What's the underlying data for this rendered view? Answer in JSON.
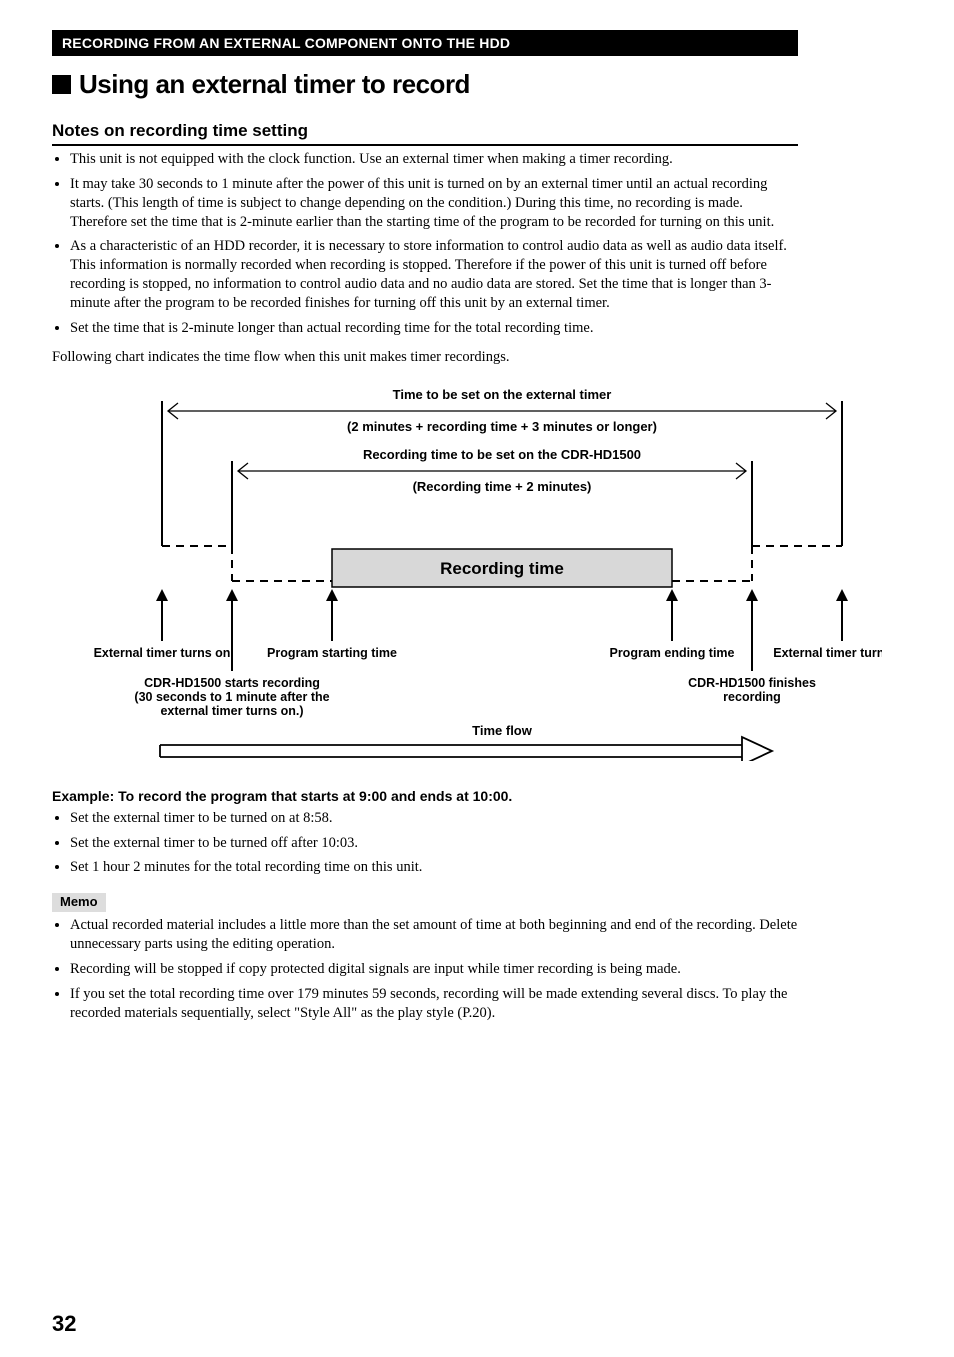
{
  "header_bar": "RECORDING FROM AN EXTERNAL COMPONENT ONTO THE HDD",
  "h1": "Using an external timer to record",
  "h2": "Notes on recording time setting",
  "notes": [
    "This unit is not equipped with the clock function. Use an external timer when making a timer recording.",
    "It may take 30 seconds to 1 minute after the power of this unit is turned on by an external timer until an actual recording starts. (This length of time is subject to change depending on the condition.) During this time, no recording is made. Therefore set the time that is 2-minute earlier than the starting time of the program to be recorded for turning on this unit.",
    "As a characteristic of an HDD recorder, it is necessary to store information to control audio data as well as audio data itself. This information is normally recorded when recording is stopped. Therefore if the power of this unit is turned off before recording is stopped, no information to control audio data and no audio data are stored. Set the time that is longer than 3-minute after the program to be recorded finishes for turning off this unit by an external timer.",
    "Set the time that is 2-minute longer than actual recording time for the total recording time."
  ],
  "followup": "Following chart indicates the time flow when this unit makes timer recordings.",
  "diagram": {
    "line1": "Time to be set on the external timer",
    "line2": "(2 minutes + recording time + 3 minutes or longer)",
    "line3": "Recording time to be set on the CDR-HD1500",
    "line4": "(Recording time + 2 minutes)",
    "rec_box": "Recording time",
    "lbl_ext_on": "External timer turns on",
    "lbl_prog_start": "Program starting time",
    "lbl_prog_end": "Program ending time",
    "lbl_ext_off": "External timer turns off",
    "lbl_cdr_start_1": "CDR-HD1500 starts recording",
    "lbl_cdr_start_2": "(30 seconds to 1 minute after the",
    "lbl_cdr_start_3": "external timer turns on.)",
    "lbl_cdr_end_1": "CDR-HD1500 finishes",
    "lbl_cdr_end_2": "recording",
    "time_flow": "Time flow"
  },
  "example_head": "Example: To record the program that starts at 9:00 and ends at 10:00.",
  "example_items": [
    "Set the external timer to be turned on at 8:58.",
    "Set the external timer to be turned off after 10:03.",
    "Set 1 hour 2 minutes for the total recording time on this unit."
  ],
  "memo_label": "Memo",
  "memo_items": [
    "Actual recorded material includes a little more than the set amount of time at both beginning and end of the recording. Delete unnecessary parts using the editing operation.",
    "Recording will be stopped if copy protected digital signals are input while timer recording is being made.",
    "If you set the total recording time over 179 minutes 59 seconds, recording will be made extending several discs. To play the recorded materials sequentially, select \"Style All\" as the play style (P.20)."
  ],
  "pagenum": "32"
}
